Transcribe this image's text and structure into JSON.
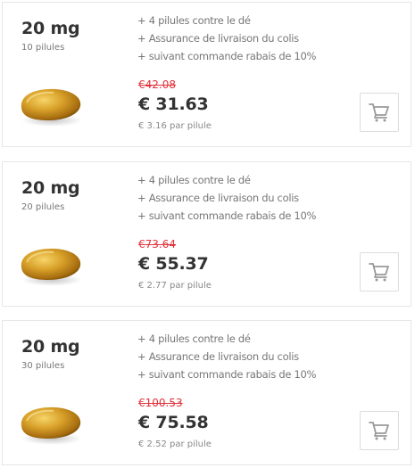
{
  "products": [
    {
      "dose": "20 mg",
      "count": "10 pilules",
      "features": [
        "+ 4 pilules contre le dé",
        "+ Assurance de livraison du colis",
        "+ suivant commande rabais de 10%"
      ],
      "old_price": "€42.08",
      "price": "€ 31.63",
      "per_pill": "€ 3.16 par pilule",
      "cart_icon": "cart-icon"
    },
    {
      "dose": "20 mg",
      "count": "20 pilules",
      "features": [
        "+ 4 pilules contre le dé",
        "+ Assurance de livraison du colis",
        "+ suivant commande rabais de 10%"
      ],
      "old_price": "€73.64",
      "price": "€ 55.37",
      "per_pill": "€ 2.77 par pilule",
      "cart_icon": "cart-icon"
    },
    {
      "dose": "20 mg",
      "count": "30 pilules",
      "features": [
        "+ 4 pilules contre le dé",
        "+ Assurance de livraison du colis",
        "+ suivant commande rabais de 10%"
      ],
      "old_price": "€100.53",
      "price": "€ 75.58",
      "per_pill": "€ 2.52 par pilule",
      "cart_icon": "cart-icon"
    }
  ],
  "colors": {
    "old_price": "#e0323c",
    "cart_icon": "#9a9a9a",
    "pill_gold": "#c8911a"
  }
}
